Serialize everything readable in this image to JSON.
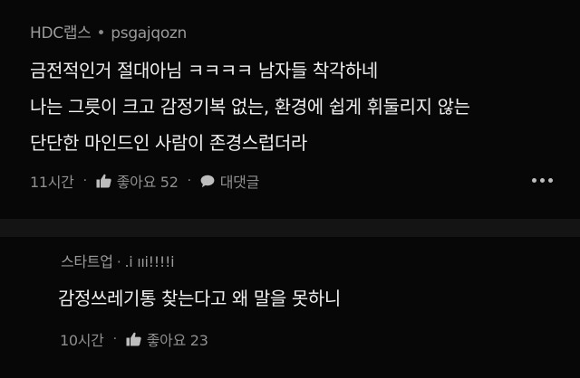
{
  "main_comment": {
    "channel": "HDC랩스",
    "separator": "•",
    "author": "psgajqozn",
    "lines": [
      "금전적인거 절대아님 ㅋㅋㅋㅋ 남자들 착각하네",
      "나는 그릇이 크고 감정기복 없는, 환경에 쉽게 휘둘리지 않는",
      "단단한 마인드인 사람이 존경스럽더라"
    ],
    "time": "11시간",
    "dot": "·",
    "like_label": "좋아요 52",
    "reply_label": "대댓글",
    "icons": {
      "like": "thumbs-up-icon",
      "reply": "speech-bubble-icon",
      "more": "more-dots-icon"
    }
  },
  "reply_comment": {
    "channel": "스타트업",
    "separator": "·",
    "author": ".i ııi!!!!i",
    "lines": [
      "감정쓰레기통 찾는다고 왜 말을 못하니"
    ],
    "time": "10시간",
    "dot": "·",
    "like_label": "좋아요 23",
    "icons": {
      "like": "thumbs-up-icon"
    }
  },
  "colors": {
    "background": "#141414",
    "card": "#070707",
    "text": "#f0f0f0",
    "muted": "#9a9a9a"
  }
}
